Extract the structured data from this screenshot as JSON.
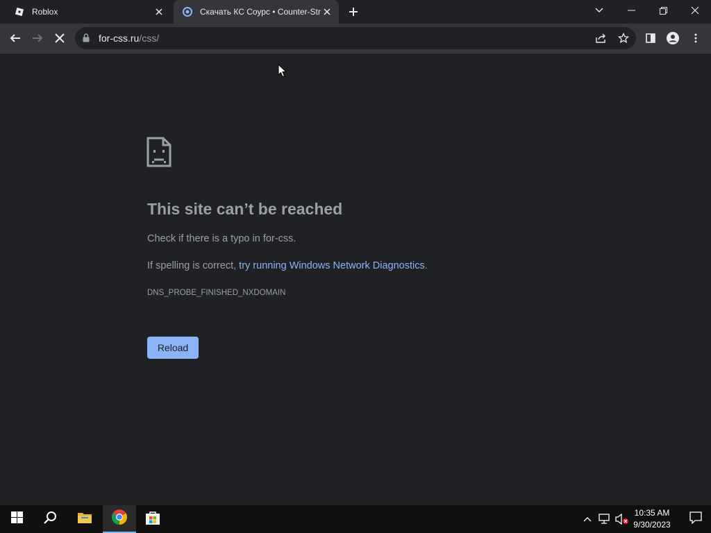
{
  "browser": {
    "tabs": [
      {
        "title": "Roblox",
        "icon": "roblox-icon"
      },
      {
        "title": "Скачать КС Соурс • Counter-Strike",
        "icon": "loading-spinner-icon",
        "active": true
      }
    ],
    "address": {
      "host": "for-css.ru",
      "path": "/css/"
    }
  },
  "error_page": {
    "title": "This site can’t be reached",
    "line1": "Check if there is a typo in for-css.",
    "line2_prefix": "If spelling is correct, ",
    "line2_link": "try running Windows Network Diagnostics",
    "line2_suffix": ".",
    "code": "DNS_PROBE_FINISHED_NXDOMAIN",
    "reload_label": "Reload"
  },
  "taskbar": {
    "apps": [
      "start-icon",
      "search-icon",
      "file-explorer-icon",
      "chrome-icon",
      "microsoft-store-icon"
    ],
    "clock": {
      "time": "10:35 AM",
      "date": "9/30/2023"
    }
  },
  "colors": {
    "page_bg": "#202124",
    "toolbar_bg": "#35363a",
    "link": "#8ab4f8",
    "button_bg": "#8ab4f8",
    "text_muted": "#9aa0a6",
    "taskbar_bg": "#101010"
  }
}
